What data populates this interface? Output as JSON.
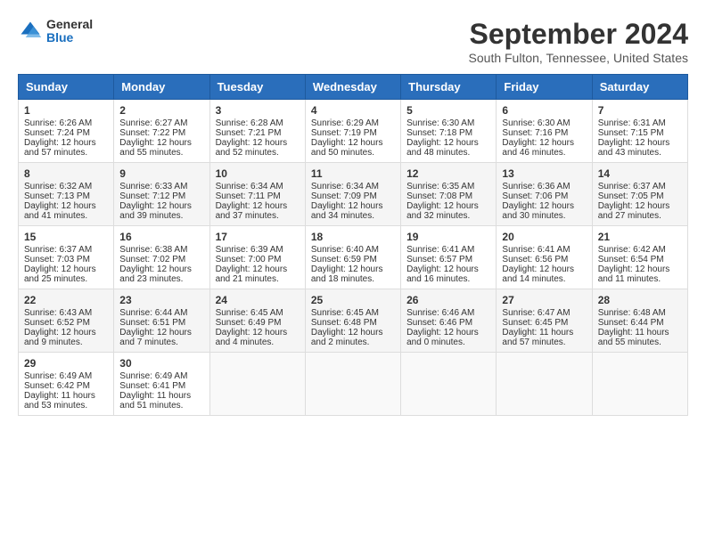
{
  "header": {
    "logo_general": "General",
    "logo_blue": "Blue",
    "title": "September 2024",
    "subtitle": "South Fulton, Tennessee, United States"
  },
  "days_of_week": [
    "Sunday",
    "Monday",
    "Tuesday",
    "Wednesday",
    "Thursday",
    "Friday",
    "Saturday"
  ],
  "weeks": [
    [
      {
        "day": 1,
        "sunrise": "6:26 AM",
        "sunset": "7:24 PM",
        "daylight": "12 hours and 57 minutes."
      },
      {
        "day": 2,
        "sunrise": "6:27 AM",
        "sunset": "7:22 PM",
        "daylight": "12 hours and 55 minutes."
      },
      {
        "day": 3,
        "sunrise": "6:28 AM",
        "sunset": "7:21 PM",
        "daylight": "12 hours and 52 minutes."
      },
      {
        "day": 4,
        "sunrise": "6:29 AM",
        "sunset": "7:19 PM",
        "daylight": "12 hours and 50 minutes."
      },
      {
        "day": 5,
        "sunrise": "6:30 AM",
        "sunset": "7:18 PM",
        "daylight": "12 hours and 48 minutes."
      },
      {
        "day": 6,
        "sunrise": "6:30 AM",
        "sunset": "7:16 PM",
        "daylight": "12 hours and 46 minutes."
      },
      {
        "day": 7,
        "sunrise": "6:31 AM",
        "sunset": "7:15 PM",
        "daylight": "12 hours and 43 minutes."
      }
    ],
    [
      {
        "day": 8,
        "sunrise": "6:32 AM",
        "sunset": "7:13 PM",
        "daylight": "12 hours and 41 minutes."
      },
      {
        "day": 9,
        "sunrise": "6:33 AM",
        "sunset": "7:12 PM",
        "daylight": "12 hours and 39 minutes."
      },
      {
        "day": 10,
        "sunrise": "6:34 AM",
        "sunset": "7:11 PM",
        "daylight": "12 hours and 37 minutes."
      },
      {
        "day": 11,
        "sunrise": "6:34 AM",
        "sunset": "7:09 PM",
        "daylight": "12 hours and 34 minutes."
      },
      {
        "day": 12,
        "sunrise": "6:35 AM",
        "sunset": "7:08 PM",
        "daylight": "12 hours and 32 minutes."
      },
      {
        "day": 13,
        "sunrise": "6:36 AM",
        "sunset": "7:06 PM",
        "daylight": "12 hours and 30 minutes."
      },
      {
        "day": 14,
        "sunrise": "6:37 AM",
        "sunset": "7:05 PM",
        "daylight": "12 hours and 27 minutes."
      }
    ],
    [
      {
        "day": 15,
        "sunrise": "6:37 AM",
        "sunset": "7:03 PM",
        "daylight": "12 hours and 25 minutes."
      },
      {
        "day": 16,
        "sunrise": "6:38 AM",
        "sunset": "7:02 PM",
        "daylight": "12 hours and 23 minutes."
      },
      {
        "day": 17,
        "sunrise": "6:39 AM",
        "sunset": "7:00 PM",
        "daylight": "12 hours and 21 minutes."
      },
      {
        "day": 18,
        "sunrise": "6:40 AM",
        "sunset": "6:59 PM",
        "daylight": "12 hours and 18 minutes."
      },
      {
        "day": 19,
        "sunrise": "6:41 AM",
        "sunset": "6:57 PM",
        "daylight": "12 hours and 16 minutes."
      },
      {
        "day": 20,
        "sunrise": "6:41 AM",
        "sunset": "6:56 PM",
        "daylight": "12 hours and 14 minutes."
      },
      {
        "day": 21,
        "sunrise": "6:42 AM",
        "sunset": "6:54 PM",
        "daylight": "12 hours and 11 minutes."
      }
    ],
    [
      {
        "day": 22,
        "sunrise": "6:43 AM",
        "sunset": "6:52 PM",
        "daylight": "12 hours and 9 minutes."
      },
      {
        "day": 23,
        "sunrise": "6:44 AM",
        "sunset": "6:51 PM",
        "daylight": "12 hours and 7 minutes."
      },
      {
        "day": 24,
        "sunrise": "6:45 AM",
        "sunset": "6:49 PM",
        "daylight": "12 hours and 4 minutes."
      },
      {
        "day": 25,
        "sunrise": "6:45 AM",
        "sunset": "6:48 PM",
        "daylight": "12 hours and 2 minutes."
      },
      {
        "day": 26,
        "sunrise": "6:46 AM",
        "sunset": "6:46 PM",
        "daylight": "12 hours and 0 minutes."
      },
      {
        "day": 27,
        "sunrise": "6:47 AM",
        "sunset": "6:45 PM",
        "daylight": "11 hours and 57 minutes."
      },
      {
        "day": 28,
        "sunrise": "6:48 AM",
        "sunset": "6:44 PM",
        "daylight": "11 hours and 55 minutes."
      }
    ],
    [
      {
        "day": 29,
        "sunrise": "6:49 AM",
        "sunset": "6:42 PM",
        "daylight": "11 hours and 53 minutes."
      },
      {
        "day": 30,
        "sunrise": "6:49 AM",
        "sunset": "6:41 PM",
        "daylight": "11 hours and 51 minutes."
      },
      null,
      null,
      null,
      null,
      null
    ]
  ]
}
